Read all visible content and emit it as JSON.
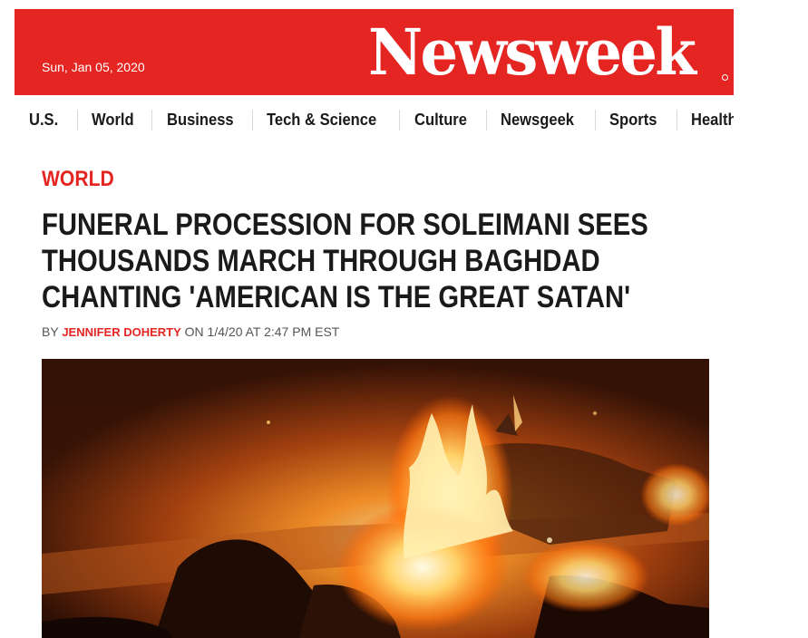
{
  "header": {
    "date": "Sun, Jan 05, 2020",
    "logo": "Newsweek"
  },
  "nav": {
    "items": [
      {
        "label": "U.S."
      },
      {
        "label": "World"
      },
      {
        "label": "Business"
      },
      {
        "label": "Tech & Science"
      },
      {
        "label": "Culture"
      },
      {
        "label": "Newsgeek"
      },
      {
        "label": "Sports"
      },
      {
        "label": "Health"
      }
    ]
  },
  "article": {
    "section": "WORLD",
    "headline": "FUNERAL PROCESSION FOR SOLEIMANI SEES THOUSANDS MARCH THROUGH BAGHDAD CHANTING 'AMERICAN IS THE GREAT SATAN'",
    "byline_prefix": "BY ",
    "author": "JENNIFER DOHERTY",
    "byline_suffix": " ON 1/4/20 AT 2:47 PM EST",
    "image_subject": "burning-vehicle-photo"
  },
  "colors": {
    "brand": "#e52521",
    "text": "#1a1a1a",
    "muted": "#555555"
  }
}
